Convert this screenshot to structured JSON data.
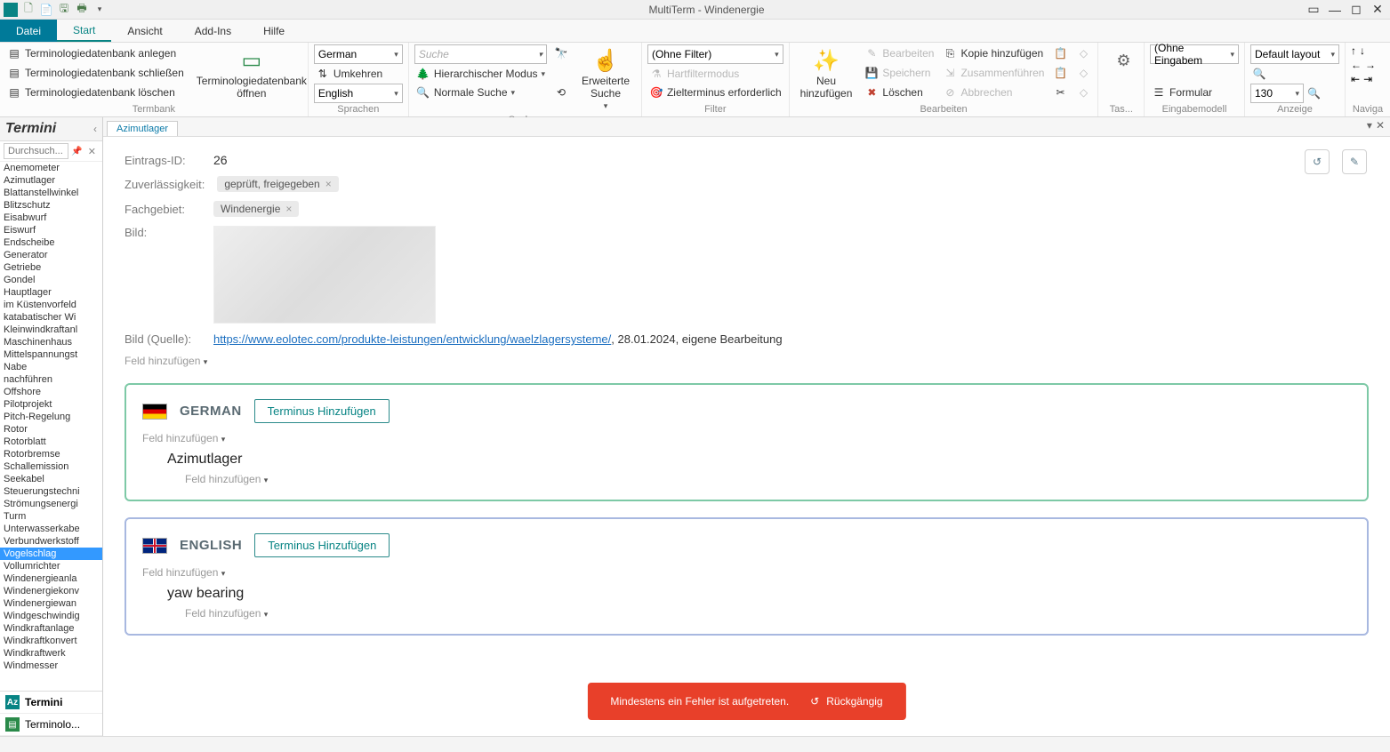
{
  "app": {
    "title": "MultiTerm - Windenergie"
  },
  "menu": {
    "file": "Datei",
    "start": "Start",
    "view": "Ansicht",
    "addins": "Add-Ins",
    "help": "Hilfe"
  },
  "ribbon": {
    "termbank": {
      "label": "Termbank",
      "create": "Terminologiedatenbank anlegen",
      "close": "Terminologiedatenbank schließen",
      "delete": "Terminologiedatenbank löschen",
      "open": "Terminologiedatenbank öffnen"
    },
    "languages": {
      "label": "Sprachen",
      "lang1": "German",
      "lang2": "English",
      "swap": "Umkehren"
    },
    "search": {
      "label": "Suchen",
      "placeholder": "Suche",
      "hier": "Hierarchischer Modus",
      "normal": "Normale Suche",
      "ext_label": "Erweiterte Suche"
    },
    "filter": {
      "label": "Filter",
      "no_filter": "(Ohne Filter)",
      "hard": "Hartfiltermodus",
      "target": "Zielterminus erforderlich"
    },
    "edit": {
      "label": "Bearbeiten",
      "new": "Neu hinzufügen",
      "edit_item": "Bearbeiten",
      "save": "Speichern",
      "delete": "Löschen",
      "copy": "Kopie hinzufügen",
      "merge": "Zusammenführen",
      "cancel": "Abbrechen"
    },
    "tasks": {
      "label": "Tas..."
    },
    "inputmodel": {
      "label": "Eingabemodell",
      "no_input": "(Ohne Eingabem",
      "form": "Formular"
    },
    "display": {
      "label": "Anzeige",
      "layout": "Default layout",
      "zoom": "130"
    },
    "navigate": {
      "label": "Naviga"
    }
  },
  "termini_panel": {
    "title": "Termini",
    "search_placeholder": "Durchsuch...",
    "pin_icon": "📌",
    "items": [
      "Anemometer",
      "Azimutlager",
      "Blattanstellwinkel",
      "Blitzschutz",
      "Eisabwurf",
      "Eiswurf",
      "Endscheibe",
      "Generator",
      "Getriebe",
      "Gondel",
      "Hauptlager",
      "im Küstenvorfeld",
      "katabatischer Wi",
      "Kleinwindkraftanl",
      "Maschinenhaus",
      "Mittelspannungst",
      "Nabe",
      "nachführen",
      "Offshore",
      "Pilotprojekt",
      "Pitch-Regelung",
      "Rotor",
      "Rotorblatt",
      "Rotorbremse",
      "Schallemission",
      "Seekabel",
      "Steuerungstechni",
      "Strömungsenergi",
      "Turm",
      "Unterwasserkabe",
      "Verbundwerkstoff",
      "Vogelschlag",
      "Vollumrichter",
      "Windenergieanla",
      "Windenergiekonv",
      "Windenergiewan",
      "Windgeschwindig",
      "Windkraftanlage",
      "Windkraftkonvert",
      "Windkraftwerk",
      "Windmesser"
    ],
    "selected_index": 31,
    "bottom_tabs": {
      "termini": "Termini",
      "terminolo": "Terminolo..."
    }
  },
  "content": {
    "tab": "Azimutlager",
    "entry_id_label": "Eintrags-ID:",
    "entry_id": "26",
    "reliability_label": "Zuverlässigkeit:",
    "reliability_value": "geprüft, freigegeben",
    "subject_label": "Fachgebiet:",
    "subject_value": "Windenergie",
    "image_label": "Bild:",
    "image_source_label": "Bild (Quelle):",
    "image_source_url": "https://www.eolotec.com/produkte-leistungen/entwicklung/waelzlagersysteme/",
    "image_source_suffix": ", 28.01.2024, eigene Bearbeitung",
    "add_field": "Feld hinzufügen",
    "german": {
      "label": "GERMAN",
      "add_term": "Terminus Hinzufügen",
      "term": "Azimutlager"
    },
    "english": {
      "label": "ENGLISH",
      "add_term": "Terminus Hinzufügen",
      "term": "yaw bearing"
    }
  },
  "error": {
    "message": "Mindestens ein Fehler ist aufgetreten.",
    "undo": "Rückgängig"
  }
}
